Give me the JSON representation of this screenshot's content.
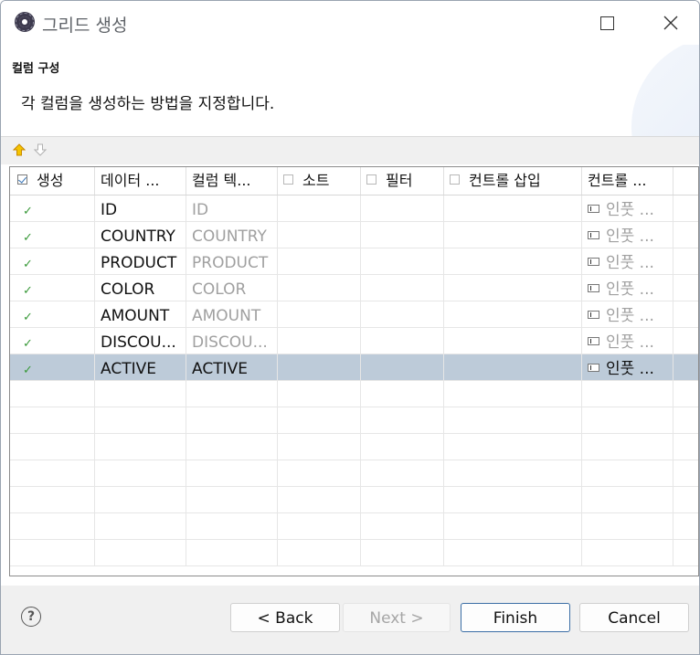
{
  "window": {
    "title": "그리드 생성",
    "icon": "eclipse-app-icon"
  },
  "header": {
    "title": "컬럼 구성",
    "description": "각 컬럼을 생성하는 방법을 지정합니다."
  },
  "toolbar": {
    "move_up": "arrow-up-icon",
    "move_down": "arrow-down-icon"
  },
  "grid": {
    "columns": [
      {
        "label": "생성",
        "checkbox": true,
        "checked": true
      },
      {
        "label": "데이터 ...",
        "checkbox": false
      },
      {
        "label": "컬럼 텍...",
        "checkbox": false
      },
      {
        "label": "소트",
        "checkbox": true,
        "checked": false
      },
      {
        "label": "필터",
        "checkbox": true,
        "checked": false
      },
      {
        "label": "컨트롤 삽입",
        "checkbox": true,
        "checked": false
      },
      {
        "label": "컨트롤 ...",
        "checkbox": false
      }
    ],
    "rows": [
      {
        "create": "✓",
        "data": "ID",
        "text": "ID",
        "control": "인풋 ..."
      },
      {
        "create": "✓",
        "data": "COUNTRY",
        "text": "COUNTRY",
        "control": "인풋 ..."
      },
      {
        "create": "✓",
        "data": "PRODUCT",
        "text": "PRODUCT",
        "control": "인풋 ..."
      },
      {
        "create": "✓",
        "data": "COLOR",
        "text": "COLOR",
        "control": "인풋 ..."
      },
      {
        "create": "✓",
        "data": "AMOUNT",
        "text": "AMOUNT",
        "control": "인풋 ..."
      },
      {
        "create": "✓",
        "data": "DISCOU...",
        "text": "DISCOU...",
        "control": "인풋 ..."
      },
      {
        "create": "✓",
        "data": "ACTIVE",
        "text": "ACTIVE",
        "control": "인풋 ..."
      }
    ],
    "selected_row": 6
  },
  "footer": {
    "help": "?",
    "back": "< Back",
    "next": "Next >",
    "finish": "Finish",
    "cancel": "Cancel"
  },
  "colors": {
    "selection": "#bdcbd9",
    "check": "#3a9a3a",
    "up_arrow": "#e8b400"
  }
}
